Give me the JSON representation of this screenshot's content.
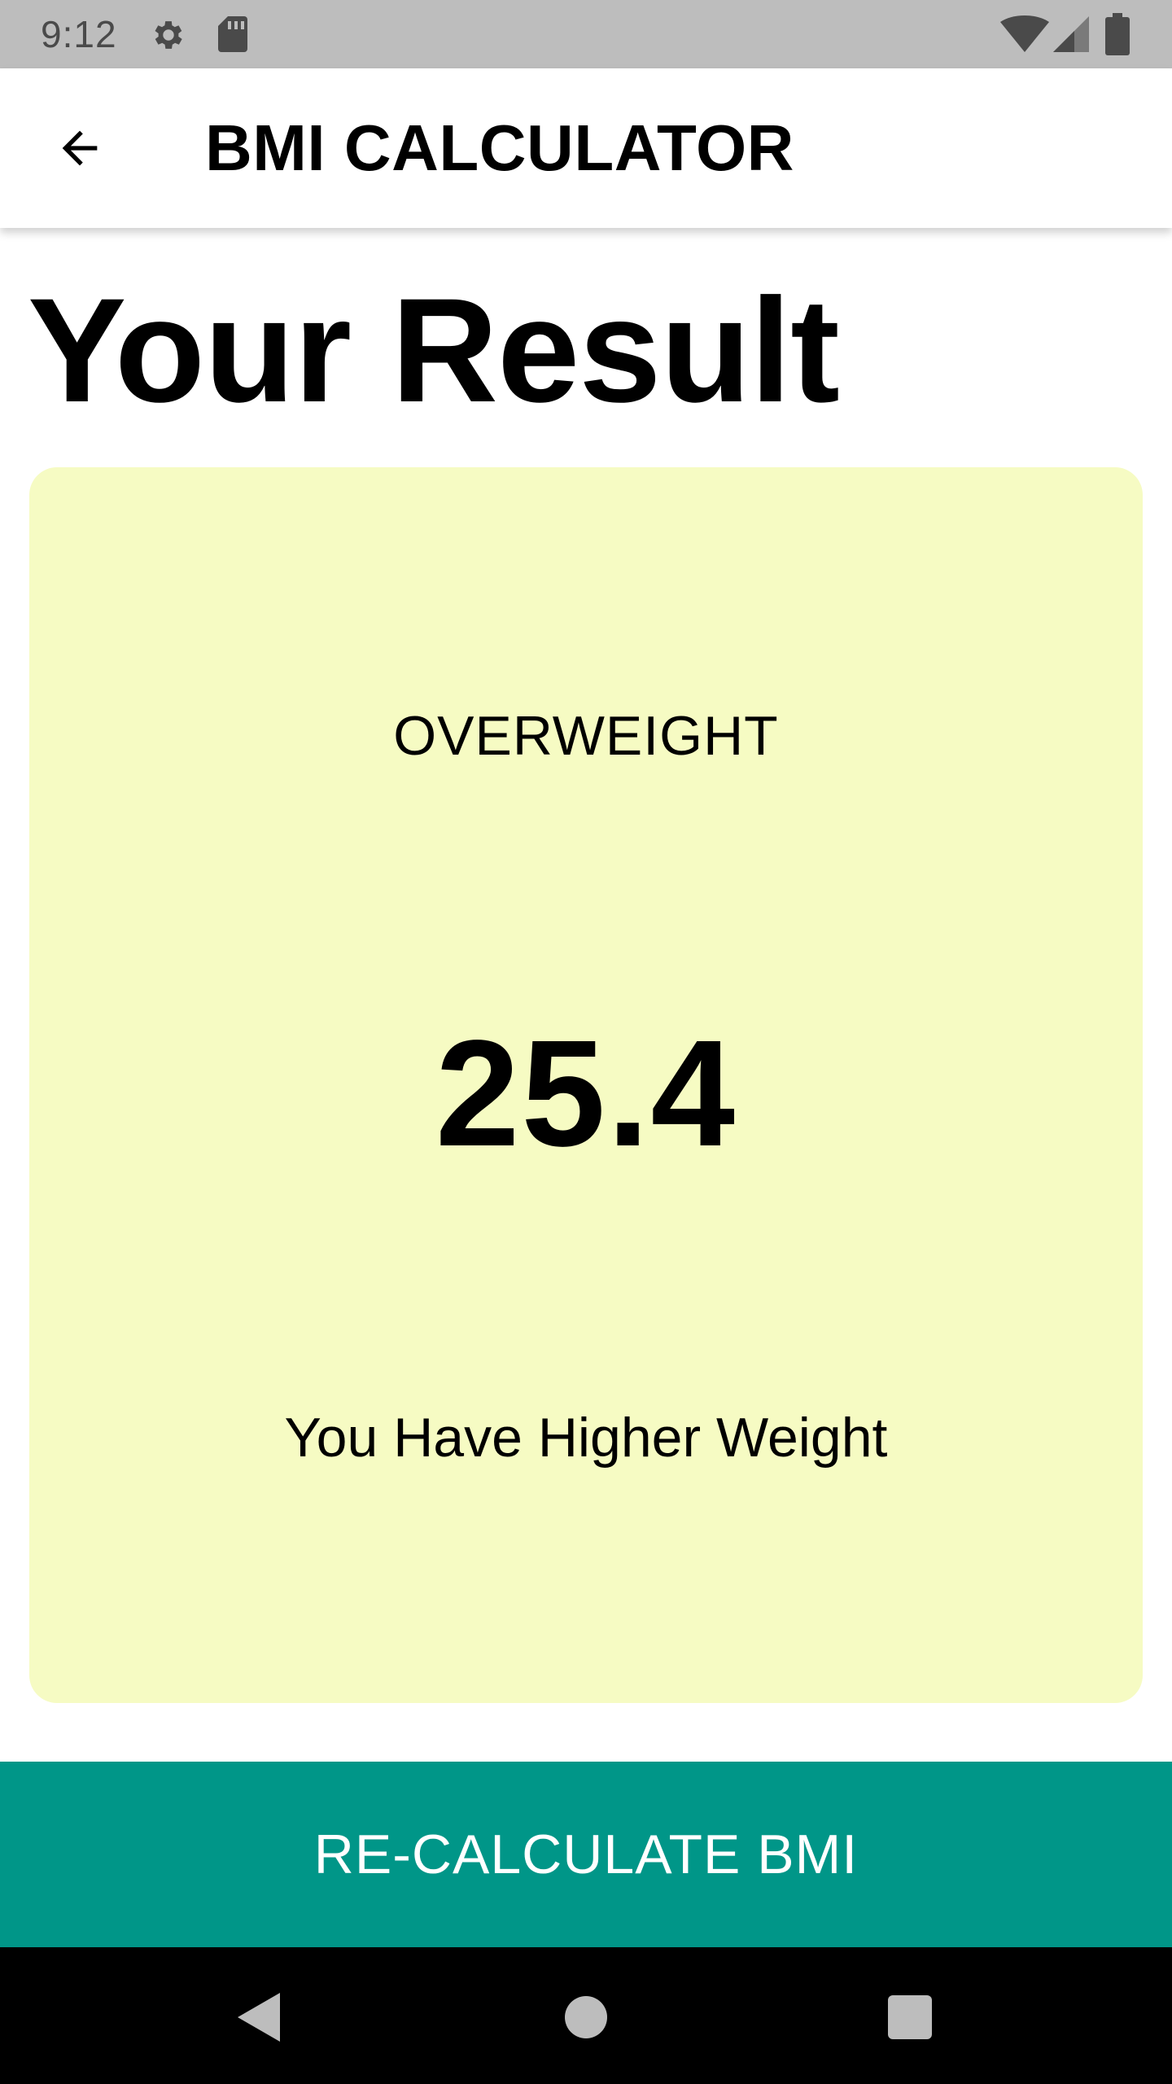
{
  "status_bar": {
    "time": "9:12",
    "icons": [
      "settings-icon",
      "sd-card-icon",
      "wifi-icon",
      "cell-signal-icon",
      "battery-icon"
    ],
    "background": "#bdbdbd"
  },
  "app_bar": {
    "title": "BMI CALCULATOR",
    "back_icon": "arrow-back-icon"
  },
  "page": {
    "heading": "Your Result"
  },
  "result": {
    "category": "OVERWEIGHT",
    "bmi_value": "25.4",
    "message": "You Have Higher Weight",
    "card_color": "#f6fbc3"
  },
  "actions": {
    "recalculate_label": "RE-CALCULATE BMI",
    "button_color": "#009688"
  },
  "nav_bar": {
    "buttons": [
      "back-triangle-icon",
      "home-circle-icon",
      "recents-square-icon"
    ]
  }
}
